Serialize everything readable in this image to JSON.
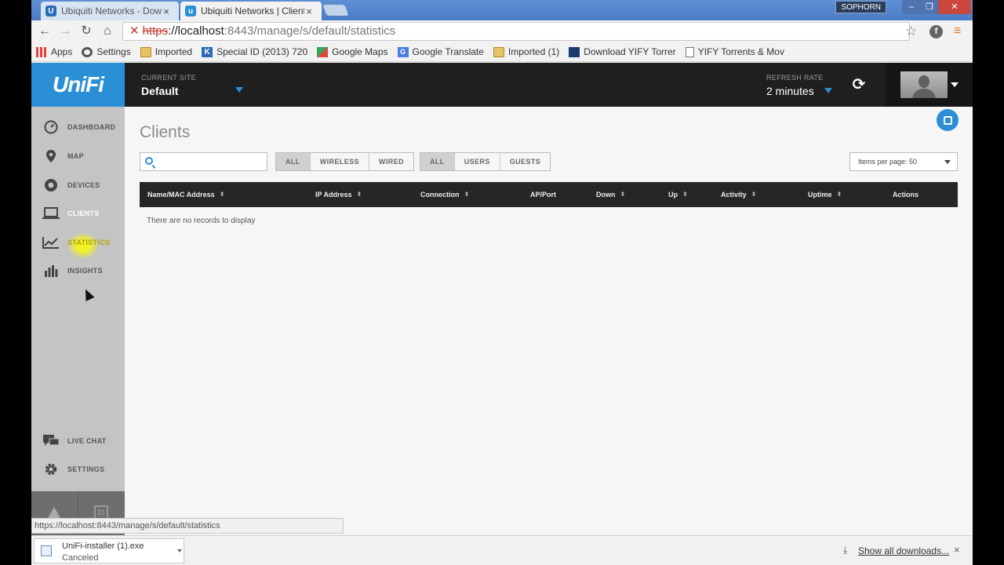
{
  "browser": {
    "tabs": [
      {
        "title": "Ubiquiti Networks - Down",
        "favicon": "U",
        "close": "×"
      },
      {
        "title": "Ubiquiti Networks | Client",
        "favicon": "u",
        "close": "×"
      }
    ],
    "user_chip": "SOPHORN",
    "window_buttons": {
      "min": "–",
      "max": "❐",
      "close": "✕"
    },
    "nav": {
      "back": "←",
      "forward": "→",
      "reload": "↻",
      "home": "⌂"
    },
    "url": {
      "scheme": "https",
      "host": "://localhost",
      "path": ":8443/manage/s/default/statistics"
    },
    "bookmarks": [
      {
        "label": "Apps",
        "icon": "apps-grid-icon"
      },
      {
        "label": "Settings",
        "icon": "gear-icon"
      },
      {
        "label": "Imported",
        "icon": "folder-icon"
      },
      {
        "label": "Special ID (2013) 720",
        "icon": "k-icon"
      },
      {
        "label": "Google Maps",
        "icon": "maps-icon"
      },
      {
        "label": "Google Translate",
        "icon": "translate-icon"
      },
      {
        "label": "Imported (1)",
        "icon": "folder-icon"
      },
      {
        "label": "Download YIFY Torrer",
        "icon": "film-icon"
      },
      {
        "label": "YIFY Torrents & Mov",
        "icon": "page-icon"
      }
    ],
    "status_url": "https://localhost:8443/manage/s/default/statistics",
    "download": {
      "name": "UniFi-installer (1).exe",
      "status": "Canceled"
    },
    "show_all_downloads": "Show all downloads...",
    "close_downloads": "×"
  },
  "app": {
    "logo": "UniFi",
    "current_site_label": "CURRENT SITE",
    "current_site_value": "Default",
    "refresh_rate_label": "REFRESH RATE",
    "refresh_rate_value": "2 minutes",
    "sidebar": [
      {
        "label": "DASHBOARD",
        "icon": "dashboard-icon"
      },
      {
        "label": "MAP",
        "icon": "map-pin-icon"
      },
      {
        "label": "DEVICES",
        "icon": "devices-icon"
      },
      {
        "label": "CLIENTS",
        "icon": "laptop-icon"
      },
      {
        "label": "STATISTICS",
        "icon": "line-chart-icon"
      },
      {
        "label": "INSIGHTS",
        "icon": "bar-chart-icon"
      }
    ],
    "sidebar_bottom": [
      {
        "label": "LIVE CHAT",
        "icon": "chat-icon"
      },
      {
        "label": "SETTINGS",
        "icon": "gear-icon"
      }
    ],
    "calendar_day": "31",
    "page_title": "Clients",
    "search_placeholder": "",
    "filter_type": [
      "ALL",
      "WIRELESS",
      "WIRED"
    ],
    "filter_user": [
      "ALL",
      "USERS",
      "GUESTS"
    ],
    "items_per_page": "Items per page: 50",
    "columns": [
      "Name/MAC Address",
      "IP Address",
      "Connection",
      "AP/Port",
      "Down",
      "Up",
      "Activity",
      "Uptime",
      "Actions"
    ],
    "no_records": "There are no records to display",
    "accent_color": "#2a8fd5"
  }
}
